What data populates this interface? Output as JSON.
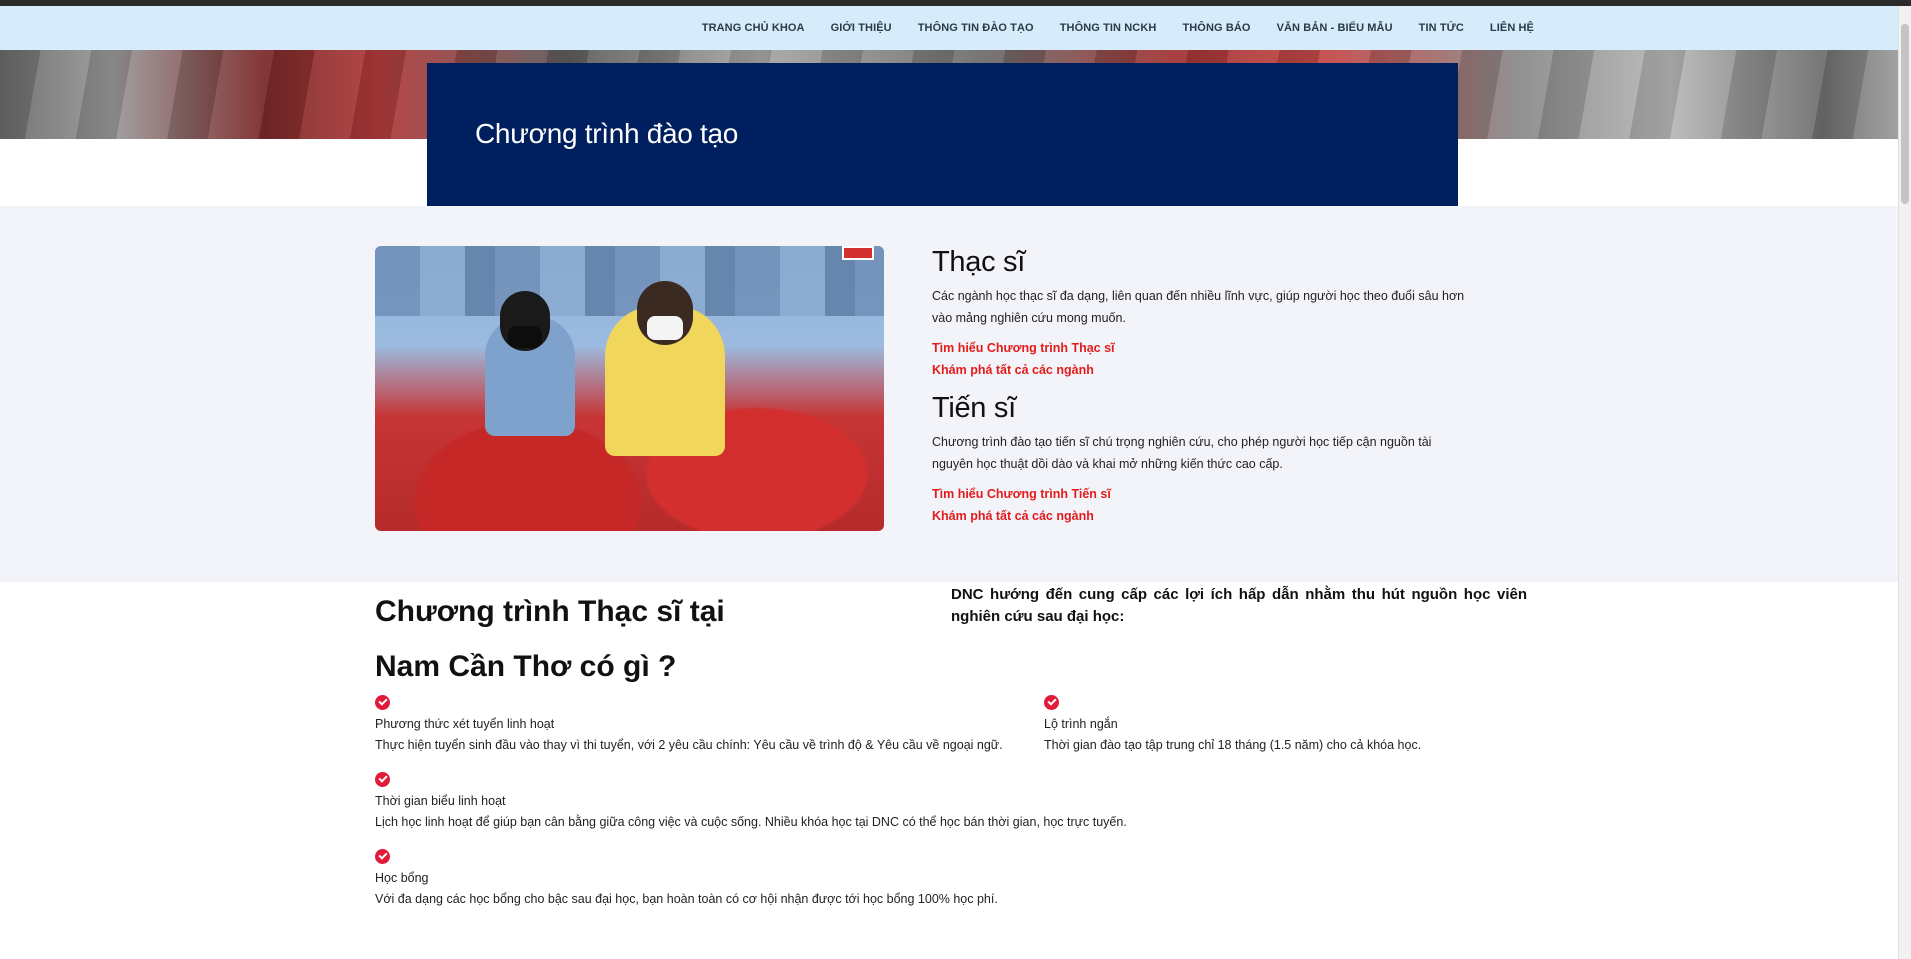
{
  "nav": {
    "items": [
      "TRANG CHỦ KHOA",
      "GIỚI THIỆU",
      "THÔNG TIN ĐÀO TẠO",
      "THÔNG TIN NCKH",
      "THÔNG BÁO",
      "VĂN BẢN - BIỂU MẪU",
      "TIN TỨC",
      "LIÊN HỆ"
    ]
  },
  "page_title": "Chương trình đào tạo",
  "programs": [
    {
      "title": "Thạc sĩ",
      "description": "Các ngành học thạc sĩ đa dạng, liên quan đến nhiều lĩnh vực, giúp người học theo đuổi sâu hơn vào mảng nghiên cứu mong muốn.",
      "link1": "Tìm hiểu Chương trình Thạc sĩ",
      "link2": "Khám phá tất cả các ngành"
    },
    {
      "title": "Tiến sĩ",
      "description": "Chương trình đào tạo tiến sĩ chú trọng nghiên cứu, cho phép người học tiếp cận nguồn tài nguyên học thuật dồi dào và khai mở những kiến thức cao cấp.",
      "link1": "Tìm hiểu Chương trình Tiến sĩ",
      "link2": "Khám phá tất cả các ngành"
    }
  ],
  "section": {
    "title": "Chương trình Thạc sĩ tại Nam Cần Thơ có gì ?",
    "intro": "DNC hướng đến cung cấp các lợi ích hấp dẫn nhằm thu hút nguồn học viên nghiên cứu sau đại học:"
  },
  "features": [
    {
      "title": "Phương thức xét tuyển linh hoạt",
      "description": "Thực hiện tuyển sinh đầu vào thay vì thi tuyển, với 2 yêu cầu chính: Yêu cầu về trình độ & Yêu cầu về ngoại ngữ."
    },
    {
      "title": "Lộ trình ngắn",
      "description": "Thời gian đào tạo tập trung chỉ 18 tháng (1.5 năm) cho cả khóa học."
    },
    {
      "title": "Thời gian biểu linh hoạt",
      "description": "Lịch học linh hoạt để giúp bạn cân bằng giữa công việc và cuộc sống. Nhiều khóa học tại DNC có thể học bán thời gian, học trực tuyến."
    },
    {
      "title": "Học bổng",
      "description": "Với đa dạng các học bổng cho bậc sau đại học, bạn hoàn toàn có cơ hội nhận được tới học bổng 100% học phí."
    }
  ],
  "colors": {
    "nav_bg": "#d6ecfa",
    "title_block_bg": "#001f5f",
    "section_bg": "#f3f4f9",
    "link_red": "#e31b1b",
    "check_red": "#e31b3b"
  }
}
